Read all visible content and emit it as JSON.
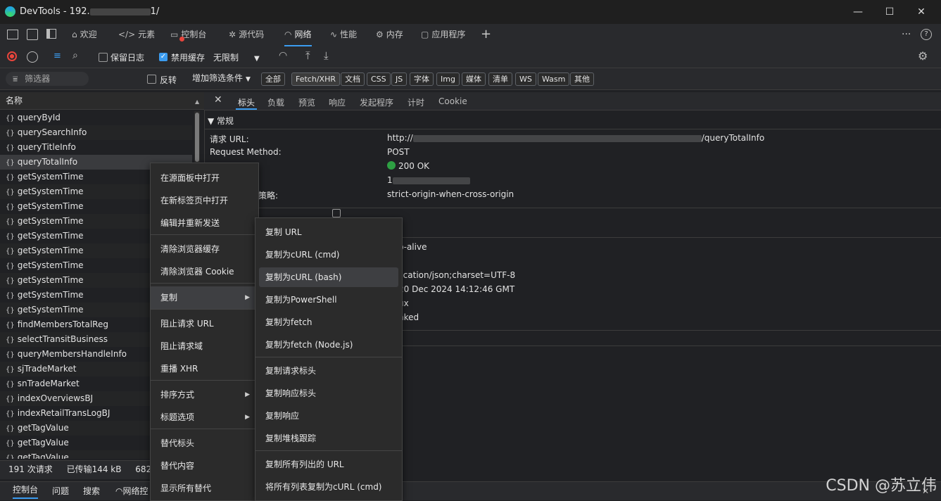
{
  "window": {
    "title": "DevTools - 192.168.x.x/",
    "title_prefix": "DevTools - 192.",
    "title_suffix": "1/"
  },
  "tabs": [
    {
      "label": "欢迎",
      "icon": "home-icon"
    },
    {
      "label": "元素",
      "icon": "code-icon"
    },
    {
      "label": "控制台",
      "icon": "console-icon"
    },
    {
      "label": "源代码",
      "icon": "bug-icon"
    },
    {
      "label": "网络",
      "icon": "wifi-icon",
      "active": true
    },
    {
      "label": "性能",
      "icon": "performance-icon"
    },
    {
      "label": "内存",
      "icon": "gear-icon"
    },
    {
      "label": "应用程序",
      "icon": "app-icon"
    }
  ],
  "toolbar": {
    "preserve_log": "保留日志",
    "disable_cache": "禁用缓存",
    "throttle": "无限制"
  },
  "filterbar": {
    "placeholder": "筛选器",
    "invert": "反转",
    "more_filters": "增加筛选条件",
    "chips": [
      "全部",
      "Fetch/XHR",
      "文档",
      "CSS",
      "JS",
      "字体",
      "Img",
      "媒体",
      "清单",
      "WS",
      "Wasm",
      "其他"
    ]
  },
  "list": {
    "header": "名称",
    "rows": [
      "queryById",
      "querySearchInfo",
      "queryTitleInfo",
      "queryTotalInfo",
      "getSystemTime",
      "getSystemTime",
      "getSystemTime",
      "getSystemTime",
      "getSystemTime",
      "getSystemTime",
      "getSystemTime",
      "getSystemTime",
      "getSystemTime",
      "getSystemTime",
      "findMembersTotalReg",
      "selectTransitBusiness",
      "queryMembersHandleInfo",
      "sjTradeMarket",
      "snTradeMarket",
      "indexOverviewsBJ",
      "indexRetailTransLogBJ",
      "getTagValue",
      "getTagValue",
      "getTagValue"
    ]
  },
  "status": {
    "requests": "191 次请求",
    "transferred": "已传输144 kB",
    "resources": "682 kB"
  },
  "drawer": {
    "tabs": [
      "控制台",
      "问题",
      "搜索",
      "网络控"
    ]
  },
  "detail": {
    "tabs": [
      "标头",
      "负载",
      "预览",
      "响应",
      "发起程序",
      "计时",
      "Cookie"
    ],
    "section": "▼ 常规",
    "general": {
      "url_label": "请求 URL:",
      "url_value": "http://",
      "url_tail": "/queryTotalInfo",
      "method_label": "Request Method:",
      "method_value": "POST",
      "status_value": "200 OK",
      "remote_value": "1",
      "referrer_label_tail": "策略:",
      "referrer_value": "strict-origin-when-cross-origin"
    },
    "headers_values": [
      "p-alive",
      "lication/json;charset=UTF-8",
      "20 Dec 2024 14:12:46 GMT",
      "ux",
      "nked"
    ]
  },
  "context_menu": {
    "items": [
      "在源面板中打开",
      "在新标签页中打开",
      "编辑并重新发送",
      "清除浏览器缓存",
      "清除浏览器 Cookie",
      "复制",
      "阻止请求 URL",
      "阻止请求域",
      "重播 XHR",
      "排序方式",
      "标题选项",
      "替代标头",
      "替代内容",
      "显示所有替代"
    ]
  },
  "copy_submenu": {
    "items": [
      "复制 URL",
      "复制为cURL (cmd)",
      "复制为cURL (bash)",
      "复制为PowerShell",
      "复制为fetch",
      "复制为fetch (Node.js)",
      "复制请求标头",
      "复制响应标头",
      "复制响应",
      "复制堆栈跟踪",
      "复制所有列出的 URL",
      "将所有列表复制为cURL (cmd)"
    ]
  },
  "watermark": "CSDN @苏立伟",
  "colors": {
    "accent": "#3b9cf0",
    "status_ok": "#2ea043",
    "record": "#e8453c"
  }
}
